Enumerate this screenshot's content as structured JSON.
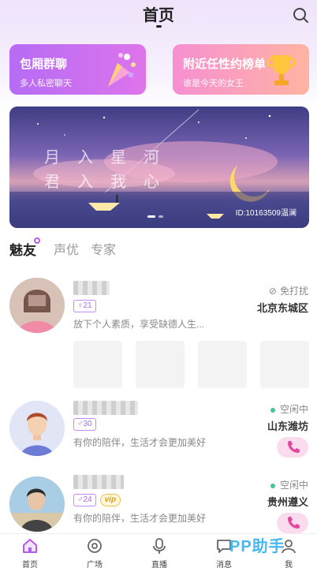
{
  "header": {
    "title": "首页"
  },
  "promo_cards": [
    {
      "title": "包厢群聊",
      "subtitle": "多人私密聊天"
    },
    {
      "title": "附近任性约榜单",
      "subtitle": "谁是今天的女王"
    }
  ],
  "banner": {
    "poem_line1": "月入星河",
    "poem_line2": "君入我心",
    "id_text": "ID:10163509温澜"
  },
  "tabs": [
    {
      "label": "魅友",
      "active": true
    },
    {
      "label": "声优",
      "active": false
    },
    {
      "label": "专家",
      "active": false
    }
  ],
  "users": [
    {
      "age": "21",
      "gender": "female",
      "bio": "放下个人素质，享受缺德人生...",
      "status": "免打扰",
      "location": "北京东城区"
    },
    {
      "age": "30",
      "gender": "male",
      "bio": "有你的陪伴，生活才会更加美好",
      "status": "空闲中",
      "location": "山东潍坊"
    },
    {
      "age": "24",
      "gender": "male",
      "vip": "vip",
      "bio": "有你的陪伴，生活才会更加美好",
      "status": "空闲中",
      "location": "贵州遵义"
    }
  ],
  "bottom_nav": [
    {
      "label": "首页",
      "active": true
    },
    {
      "label": "广场"
    },
    {
      "label": "直播"
    },
    {
      "label": "消息"
    },
    {
      "label": "我"
    }
  ],
  "watermark": "PP助手",
  "colors": {
    "accent": "#b55cf0",
    "online": "#49c38e",
    "call_bg": "#fbdcef"
  }
}
